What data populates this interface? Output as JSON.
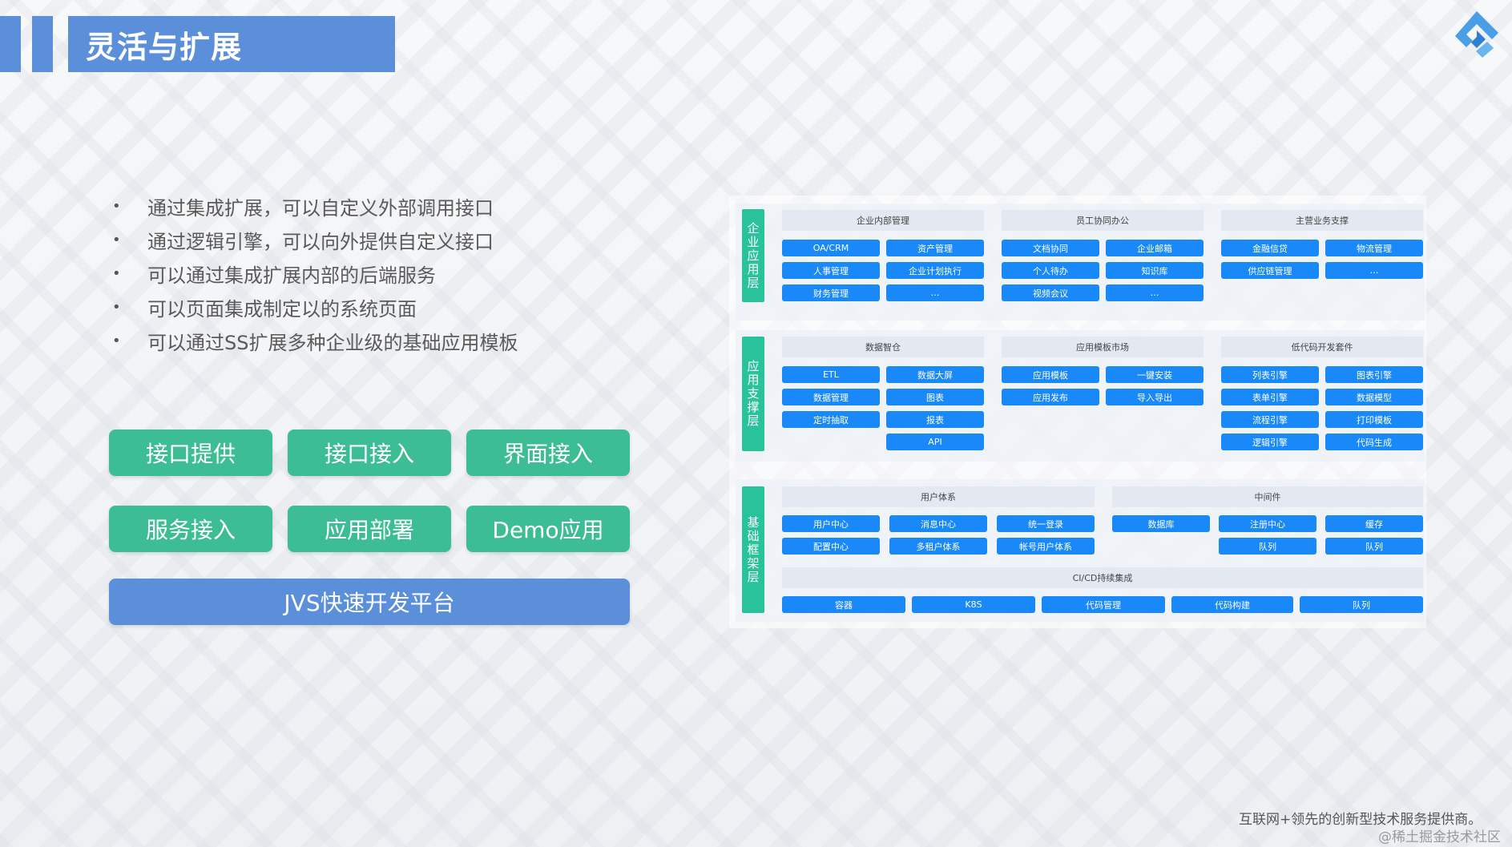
{
  "header": {
    "title": "灵活与扩展"
  },
  "bullets": [
    "通过集成扩展，可以自定义外部调用接口",
    "通过逻辑引擎，可以向外提供自定义接口",
    "可以通过集成扩展内部的后端服务",
    "可以页面集成制定以的系统页面",
    "可以通过SS扩展多种企业级的基础应用模板"
  ],
  "bullet_marker": "•",
  "buttons": {
    "api_provide": "接口提供",
    "api_access": "接口接入",
    "ui_access": "界面接入",
    "service_access": "服务接入",
    "app_deploy": "应用部署",
    "demo_app": "Demo应用",
    "platform": "JVS快速开发平台"
  },
  "architecture": {
    "layer1": {
      "label": "企业应用层",
      "sections": [
        {
          "title": "企业内部管理",
          "items": [
            "OA/CRM",
            "资产管理",
            "人事管理",
            "企业计划执行",
            "财务管理",
            "…"
          ]
        },
        {
          "title": "员工协同办公",
          "items": [
            "文档协同",
            "企业邮箱",
            "个人待办",
            "知识库",
            "视频会议",
            "…"
          ]
        },
        {
          "title": "主营业务支撑",
          "items": [
            "金融信贷",
            "物流管理",
            "供应链管理",
            "…"
          ]
        }
      ]
    },
    "layer2": {
      "label": "应用支撑层",
      "sections": [
        {
          "title": "数据智仓",
          "items": [
            "ETL",
            "数据大屏",
            "数据管理",
            "图表",
            "定时抽取",
            "报表",
            "API"
          ]
        },
        {
          "title": "应用模板市场",
          "items": [
            "应用模板",
            "一键安装",
            "应用发布",
            "导入导出"
          ]
        },
        {
          "title": "低代码开发套件",
          "items": [
            "列表引擎",
            "图表引擎",
            "表单引擎",
            "数据模型",
            "流程引擎",
            "打印模板",
            "逻辑引擎",
            "代码生成"
          ]
        }
      ]
    },
    "layer3": {
      "label": "基础框架层",
      "sections": [
        {
          "title": "用户体系",
          "items": [
            "用户中心",
            "消息中心",
            "统一登录",
            "配置中心",
            "多租户体系",
            "帐号用户体系"
          ]
        },
        {
          "title": "中间件",
          "items": [
            "数据库",
            "注册中心",
            "缓存",
            "队列",
            "队列"
          ]
        },
        {
          "title": "CI/CD持续集成",
          "items": [
            "容器",
            "K8S",
            "代码管理",
            "代码构建",
            "队列"
          ]
        }
      ]
    }
  },
  "footer": {
    "tagline": "互联网+领先的创新型技术服务提供商。",
    "watermark": "@稀土掘金技术社区"
  },
  "colors": {
    "title_blue": "#5b8fd9",
    "button_green": "#3dbd93",
    "layer_green": "#28c39a",
    "chip_blue": "#1989fa"
  },
  "icons": [
    "logo-icon"
  ]
}
